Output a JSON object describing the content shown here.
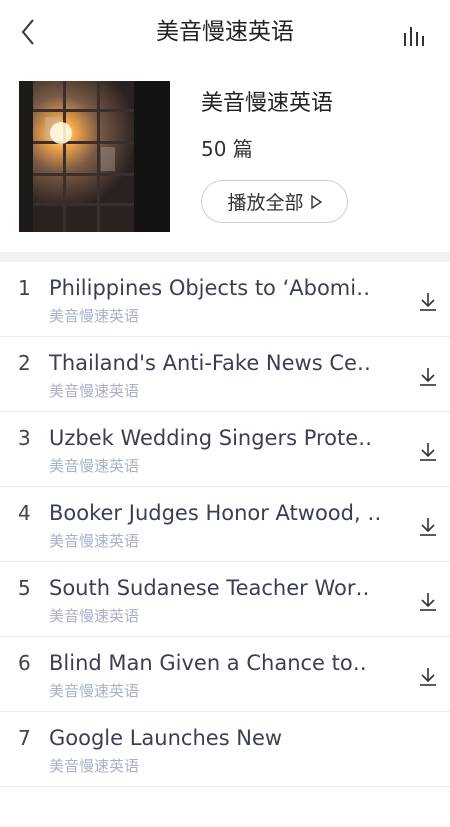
{
  "nav": {
    "title": "美音慢速英语",
    "back_icon": "chevron-left-icon",
    "stats_icon": "bar-chart-icon"
  },
  "album": {
    "title": "美音慢速英语",
    "count": "50 篇",
    "play_all_label": "播放全部",
    "play_icon": "play-outline-icon"
  },
  "tracks": [
    {
      "index": "1",
      "title": "Philippines Objects to ‘Abomi‥",
      "subtitle": "美音慢速英语"
    },
    {
      "index": "2",
      "title": "Thailand's Anti-Fake News Ce‥",
      "subtitle": "美音慢速英语"
    },
    {
      "index": "3",
      "title": "Uzbek Wedding Singers Prote‥",
      "subtitle": "美音慢速英语"
    },
    {
      "index": "4",
      "title": "Booker Judges Honor Atwood, ‥",
      "subtitle": "美音慢速英语"
    },
    {
      "index": "5",
      "title": "South Sudanese Teacher Wor‥",
      "subtitle": "美音慢速英语"
    },
    {
      "index": "6",
      "title": "Blind Man Given a Chance to‥",
      "subtitle": "美音慢速英语"
    },
    {
      "index": "7",
      "title": "Google Launches New",
      "subtitle": "美音慢速英语"
    }
  ],
  "colors": {
    "title_text": "#3a3f55",
    "subtitle_text": "#aab1c8",
    "band": "#f2f2f2"
  }
}
